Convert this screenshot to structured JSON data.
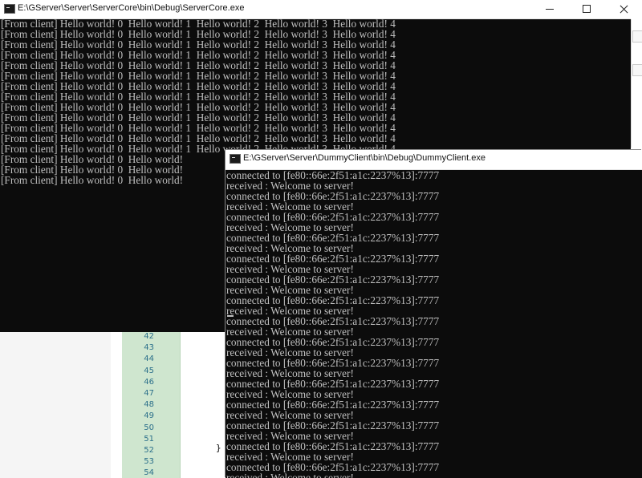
{
  "server_window": {
    "title": "E:\\GServer\\Server\\ServerCore\\bin\\Debug\\ServerCore.exe",
    "lines": [
      "[From client] Hello world! 0  Hello world! 1  Hello world! 2  Hello world! 3  Hello world! 4",
      "[From client] Hello world! 0  Hello world! 1  Hello world! 2  Hello world! 3  Hello world! 4",
      "[From client] Hello world! 0  Hello world! 1  Hello world! 2  Hello world! 3  Hello world! 4",
      "[From client] Hello world! 0  Hello world! 1  Hello world! 2  Hello world! 3  Hello world! 4",
      "[From client] Hello world! 0  Hello world! 1  Hello world! 2  Hello world! 3  Hello world! 4",
      "[From client] Hello world! 0  Hello world! 1  Hello world! 2  Hello world! 3  Hello world! 4",
      "[From client] Hello world! 0  Hello world! 1  Hello world! 2  Hello world! 3  Hello world! 4",
      "[From client] Hello world! 0  Hello world! 1  Hello world! 2  Hello world! 3  Hello world! 4",
      "[From client] Hello world! 0  Hello world! 1  Hello world! 2  Hello world! 3  Hello world! 4",
      "[From client] Hello world! 0  Hello world! 1  Hello world! 2  Hello world! 3  Hello world! 4",
      "[From client] Hello world! 0  Hello world! 1  Hello world! 2  Hello world! 3  Hello world! 4",
      "[From client] Hello world! 0  Hello world! 1  Hello world! 2  Hello world! 3  Hello world! 4",
      "[From client] Hello world! 0  Hello world! 1  Hello world! 2  Hello world! 3  Hello world! 4",
      "[From client] Hello world! 0  Hello world!",
      "[From client] Hello world! 0  Hello world!",
      "[From client] Hello world! 0  Hello world!"
    ]
  },
  "client_window": {
    "title": "E:\\GServer\\Server\\DummyClient\\bin\\Debug\\DummyClient.exe",
    "lines": [
      "connected to [fe80::66e:2f51:a1c:2237%13]:7777",
      "received : Welcome to server!",
      "connected to [fe80::66e:2f51:a1c:2237%13]:7777",
      "received : Welcome to server!",
      "connected to [fe80::66e:2f51:a1c:2237%13]:7777",
      "received : Welcome to server!",
      "connected to [fe80::66e:2f51:a1c:2237%13]:7777",
      "received : Welcome to server!",
      "connected to [fe80::66e:2f51:a1c:2237%13]:7777",
      "received : Welcome to server!",
      "connected to [fe80::66e:2f51:a1c:2237%13]:7777",
      "received : Welcome to server!",
      "connected to [fe80::66e:2f51:a1c:2237%13]:7777",
      "received : Welcome to server!",
      "connected to [fe80::66e:2f51:a1c:2237%13]:7777",
      "received : Welcome to server!",
      "connected to [fe80::66e:2f51:a1c:2237%13]:7777",
      "received : Welcome to server!",
      "connected to [fe80::66e:2f51:a1c:2237%13]:7777",
      "received : Welcome to server!",
      "connected to [fe80::66e:2f51:a1c:2237%13]:7777",
      "received : Welcome to server!",
      "connected to [fe80::66e:2f51:a1c:2237%13]:7777",
      "received : Welcome to server!",
      "connected to [fe80::66e:2f51:a1c:2237%13]:7777",
      "received : Welcome to server!",
      "connected to [fe80::66e:2f51:a1c:2237%13]:7777",
      "received : Welcome to server!",
      "connected to [fe80::66e:2f51:a1c:2237%13]:7777",
      "received : Welcome to server!",
      "connected to [fe80::66e:2f51:a1c:2237%13]:7777"
    ]
  },
  "editor": {
    "line_numbers": [
      "42",
      "43",
      "44",
      "45",
      "46",
      "47",
      "48",
      "49",
      "50",
      "51",
      "52",
      "53",
      "54"
    ],
    "closing_brace": "}"
  },
  "colors": {
    "console_background": "#0c0c0c",
    "console_text": "#c0c0c0",
    "line_number_margin": "#cfe6cf",
    "line_number_text": "#2b6f8a"
  }
}
